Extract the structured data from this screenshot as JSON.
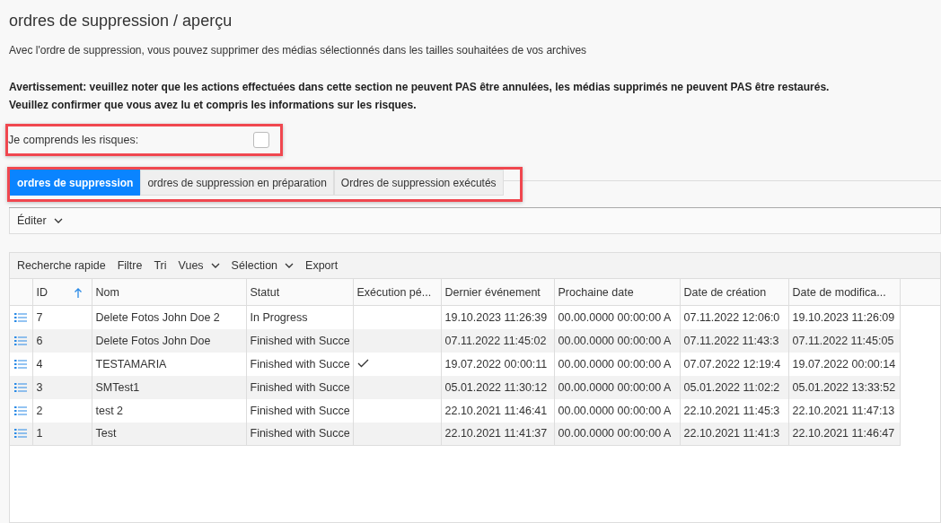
{
  "page": {
    "title": "ordres de suppression / aperçu",
    "description": "Avec l'ordre de suppression, vous pouvez supprimer des médias sélectionnés dans les tailles souhaitées de vos archives",
    "warning_lines": [
      "Avertissement: veuillez noter que les actions effectuées dans cette section ne peuvent PAS être annulées, les médias supprimés ne peuvent PAS être restaurés.",
      "Veuillez confirmer que vous avez lu et compris les informations sur les risques."
    ]
  },
  "risk_confirmation": {
    "label": "Je comprends les risques:",
    "checked": false
  },
  "tabs": [
    {
      "label": "ordres de suppression",
      "selected": true
    },
    {
      "label": "ordres de suppression en préparation",
      "selected": false
    },
    {
      "label": "Ordres de suppression exécutés",
      "selected": false
    }
  ],
  "edit_menu": {
    "label": "Éditer"
  },
  "grid_toolbar": [
    {
      "label": "Recherche rapide",
      "dropdown": false
    },
    {
      "label": "Filtre",
      "dropdown": false
    },
    {
      "label": "Tri",
      "dropdown": false
    },
    {
      "label": "Vues",
      "dropdown": true
    },
    {
      "label": "Sélection",
      "dropdown": true
    },
    {
      "label": "Export",
      "dropdown": false
    }
  ],
  "table": {
    "columns": [
      {
        "label": "ID",
        "sorted": true
      },
      {
        "label": "Nom",
        "sorted": false
      },
      {
        "label": "Statut",
        "sorted": false
      },
      {
        "label": "Exécution pé...",
        "sorted": false
      },
      {
        "label": "Dernier événement",
        "sorted": false
      },
      {
        "label": "Prochaine date",
        "sorted": false
      },
      {
        "label": "Date de création",
        "sorted": false
      },
      {
        "label": "Date de modifica...",
        "sorted": false
      }
    ],
    "rows": [
      {
        "id": "7",
        "name": "Delete Fotos John Doe 2",
        "status": "In Progress",
        "executed": false,
        "last_event": "19.10.2023 11:26:39",
        "next_date": "00.00.0000 00:00:00 A",
        "created": "07.11.2022 12:06:0",
        "modified": "19.10.2023 11:26:09"
      },
      {
        "id": "6",
        "name": "Delete Fotos John Doe",
        "status": "Finished with Succe",
        "executed": false,
        "last_event": "07.11.2022 11:45:02",
        "next_date": "00.00.0000 00:00:00 A",
        "created": "07.11.2022 11:43:3",
        "modified": "07.11.2022 11:45:05"
      },
      {
        "id": "4",
        "name": "TESTAMARIA",
        "status": "Finished with Succe",
        "executed": true,
        "last_event": "19.07.2022 00:00:11",
        "next_date": "00.00.0000 00:00:00 A",
        "created": "07.07.2022 12:19:4",
        "modified": "19.07.2022 00:00:14"
      },
      {
        "id": "3",
        "name": "SMTest1",
        "status": "Finished with Succe",
        "executed": false,
        "last_event": "05.01.2022 11:30:12",
        "next_date": "00.00.0000 00:00:00 A",
        "created": "05.01.2022 11:02:2",
        "modified": "05.01.2022 13:33:52"
      },
      {
        "id": "2",
        "name": "test 2",
        "status": "Finished with Succe",
        "executed": false,
        "last_event": "22.10.2021 11:46:41",
        "next_date": "00.00.0000 00:00:00 A",
        "created": "22.10.2021 11:45:3",
        "modified": "22.10.2021 11:47:13"
      },
      {
        "id": "1",
        "name": "Test",
        "status": "Finished with Succe",
        "executed": false,
        "last_event": "22.10.2021 11:41:37",
        "next_date": "00.00.0000 00:00:00 A",
        "created": "22.10.2021 11:41:3",
        "modified": "22.10.2021 11:46:47"
      }
    ]
  }
}
